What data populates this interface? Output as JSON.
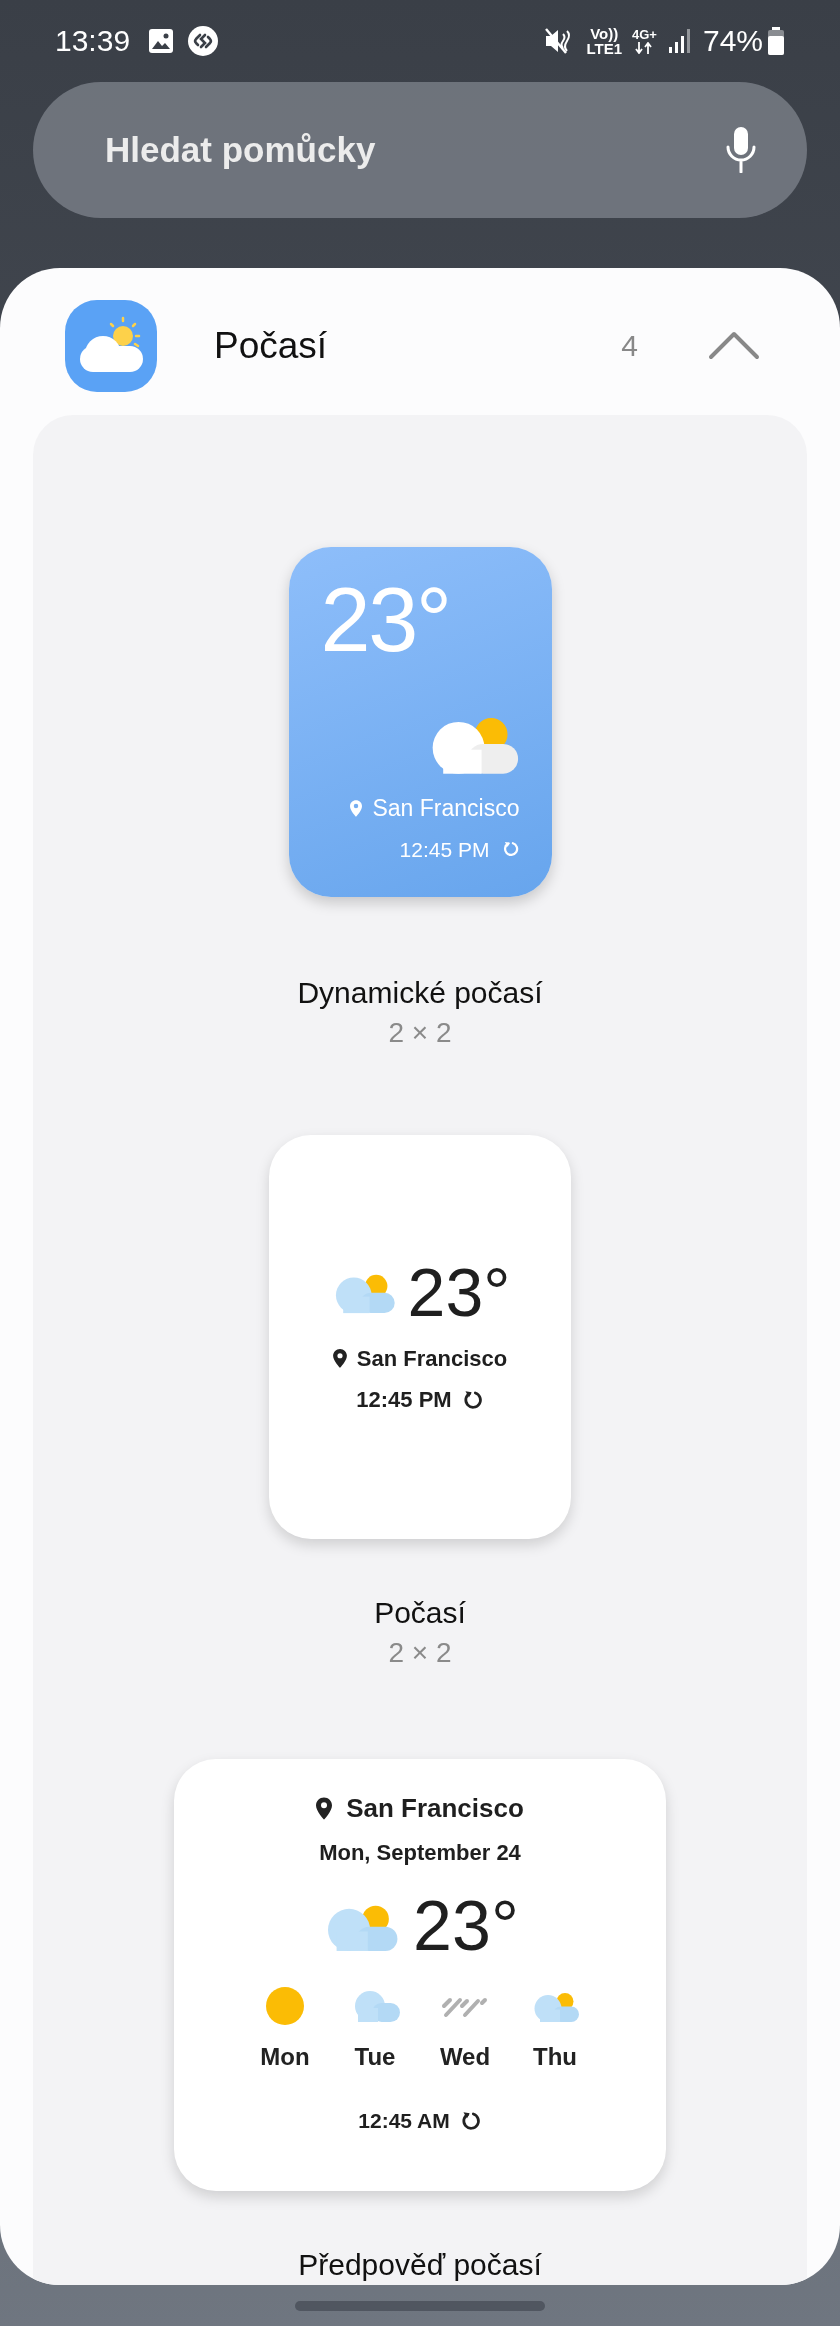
{
  "status_bar": {
    "time": "13:39",
    "volte_top": "Vo))",
    "volte_bottom": "LTE1",
    "data_type": "4G+",
    "battery": "74%"
  },
  "search": {
    "placeholder": "Hledat pomůcky"
  },
  "app": {
    "name": "Počasí",
    "count": "4",
    "expanded": true
  },
  "widgets": [
    {
      "kind": "dynamic",
      "temperature": "23°",
      "location": "San Francisco",
      "time": "12:45 PM",
      "name": "Dynamické počasí",
      "size": "2 × 2"
    },
    {
      "kind": "compact",
      "temperature": "23°",
      "location": "San Francisco",
      "time": "12:45 PM",
      "name": "Počasí",
      "size": "2 × 2"
    },
    {
      "kind": "forecast",
      "location": "San Francisco",
      "date": "Mon, September 24",
      "temperature": "23°",
      "time": "12:45 AM",
      "name": "Předpověď počasí",
      "days": [
        {
          "day": "Mon",
          "kind": "sunny"
        },
        {
          "day": "Tue",
          "kind": "cloudy"
        },
        {
          "day": "Wed",
          "kind": "rain"
        },
        {
          "day": "Thu",
          "kind": "partly_cloudy"
        }
      ]
    }
  ]
}
